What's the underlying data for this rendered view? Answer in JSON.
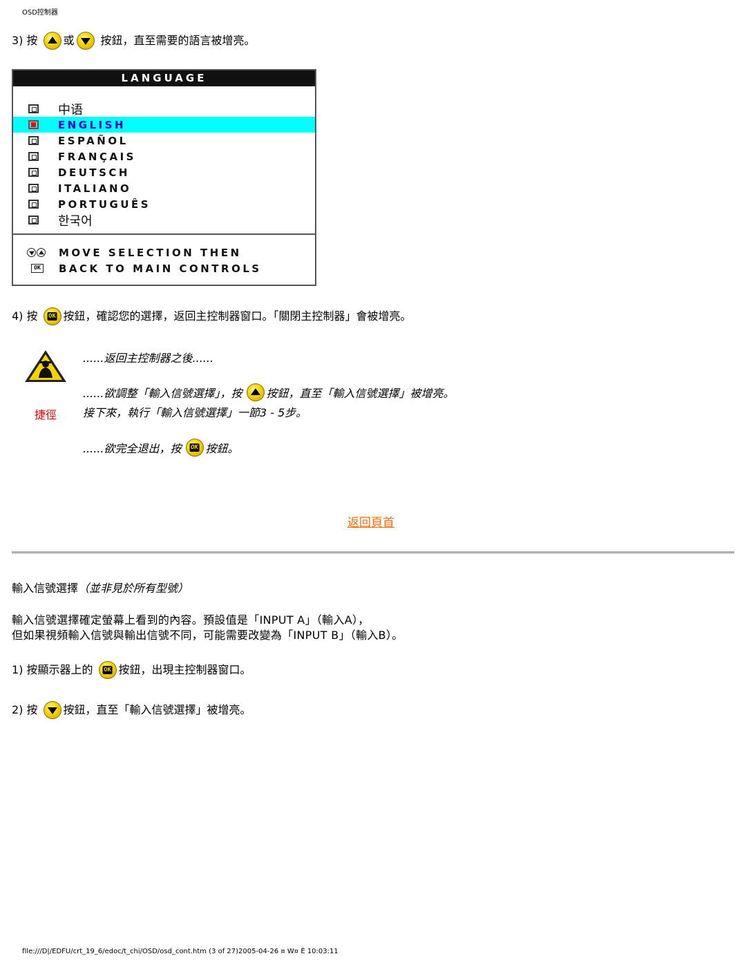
{
  "header": {
    "title": "OSD控制器"
  },
  "step3": {
    "prefix": "3) 按",
    "or": "或",
    "suffix": "按鈕，直至需要的語言被增亮。"
  },
  "osd": {
    "title": "LANGUAGE",
    "items": [
      {
        "label": "中语",
        "selected": false
      },
      {
        "label": "ENGLISH",
        "selected": true
      },
      {
        "label": "ESPAÑOL",
        "selected": false
      },
      {
        "label": "FRANÇAIS",
        "selected": false
      },
      {
        "label": "DEUTSCH",
        "selected": false
      },
      {
        "label": "ITALIANO",
        "selected": false
      },
      {
        "label": "PORTUGUÊS",
        "selected": false
      },
      {
        "label": "한국어",
        "selected": false
      }
    ],
    "footer": {
      "line1": "MOVE SELECTION THEN",
      "line2": "BACK TO MAIN CONTROLS",
      "ok_glyph": "OK"
    },
    "highlight_color": "#00ffff"
  },
  "step4": {
    "prefix": "4) 按",
    "suffix": "按鈕，確認您的選擇，返回主控制器窗口。「關閉主控制器」會被增亮。"
  },
  "tips": {
    "line1": "......返回主控制器之後......",
    "line2_prefix": "......欲調整「輸入信號選擇」，按",
    "line2_suffix": "按鈕，直至「輸入信號選擇」被增亮。",
    "line3": "接下來，執行「輸入信號選擇」一節3 - 5步。",
    "line4_prefix": "......欲完全退出，按",
    "line4_suffix": "按鈕。",
    "shortcut_label": "捷徑"
  },
  "icons": {
    "ok_label": "OK"
  },
  "back_to_top": {
    "label": "返回頁首",
    "color": "#ff6a00"
  },
  "input_section": {
    "title": "輸入信號選擇",
    "title_note": "（並非見於所有型號）",
    "para1": "輸入信號選擇確定螢幕上看到的內容。預設值是「INPUT A」（輸入A），",
    "para2": "但如果視頻輸入信號與輸出信號不同，可能需要改變為「INPUT B」（輸入B）。",
    "step1_prefix": "1) 按顯示器上的",
    "step1_suffix": "按鈕，出現主控制器窗口。",
    "step2_prefix": "2) 按",
    "step2_suffix": "按鈕，直至「輸入信號選擇」被增亮。"
  },
  "footer": {
    "path": "file:///D|/EDFU/crt_19_6/edoc/t_chi/OSD/osd_cont.htm (3 of 27)2005-04-26 ¤ W¤ È  10:03:11"
  }
}
